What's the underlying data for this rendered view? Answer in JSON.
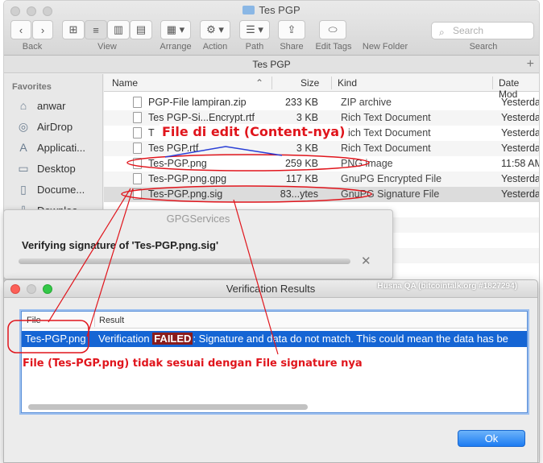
{
  "finder": {
    "title": "Tes PGP",
    "toolbar": {
      "back_label": "Back",
      "view_label": "View",
      "arrange_label": "Arrange",
      "action_label": "Action",
      "path_label": "Path",
      "share_label": "Share",
      "edit_tags_label": "Edit Tags",
      "new_folder_label": "New Folder",
      "search_placeholder": "Search",
      "search_label": "Search"
    },
    "path_title": "Tes PGP",
    "sidebar": {
      "heading": "Favorites",
      "items": [
        {
          "label": "anwar",
          "icon": "home-icon"
        },
        {
          "label": "AirDrop",
          "icon": "airdrop-icon"
        },
        {
          "label": "Applicati...",
          "icon": "applications-icon"
        },
        {
          "label": "Desktop",
          "icon": "desktop-icon"
        },
        {
          "label": "Docume...",
          "icon": "document-icon"
        },
        {
          "label": "Downloa...",
          "icon": "download-icon"
        }
      ]
    },
    "columns": {
      "name": "Name",
      "size": "Size",
      "kind": "Kind",
      "date": "Date Mod"
    },
    "files": [
      {
        "name": "PGP-File lampiran.zip",
        "size": "233 KB",
        "kind": "ZIP archive",
        "date": "Yesterday"
      },
      {
        "name": "Tes PGP-Si...Encrypt.rtf",
        "size": "3 KB",
        "kind": "Rich Text Document",
        "date": "Yesterday"
      },
      {
        "name": "T",
        "size": "",
        "kind": "Rich Text Document",
        "date": "Yesterday"
      },
      {
        "name": "Tes PGP.rtf",
        "size": "3 KB",
        "kind": "Rich Text Document",
        "date": "Yesterday"
      },
      {
        "name": "Tes-PGP.png",
        "size": "259 KB",
        "kind": "PNG image",
        "date": "11:58 AM"
      },
      {
        "name": "Tes-PGP.png.gpg",
        "size": "117 KB",
        "kind": "GnuPG Encrypted File",
        "date": "Yesterday"
      },
      {
        "name": "Tes-PGP.png.sig",
        "size": "83...ytes",
        "kind": "GnuPG Signature File",
        "date": "Yesterday"
      }
    ]
  },
  "gpg_services": {
    "title": "GPGServices",
    "message": "Verifying signature of 'Tes-PGP.png.sig'"
  },
  "verification": {
    "title": "Verification Results",
    "watermark": "Husna QA (bitcointalk.org #1827294)",
    "col_file": "File",
    "col_result": "Result",
    "row": {
      "file": "Tes-PGP.png",
      "result_prefix": "Verification ",
      "result_status": "FAILED",
      "result_rest": ": Signature and data do not match. This could mean the data has be"
    },
    "ok_label": "Ok"
  },
  "annotations": {
    "top": "File di edit (Content-nya)",
    "bottom": "File (Tes-PGP.png) tidak sesuai dengan File signature nya",
    "color": "#e0151c"
  },
  "colors": {
    "selection": "#1565d4",
    "failed_bg": "#8a1c1c",
    "ok_button": "#1d7cf2"
  }
}
